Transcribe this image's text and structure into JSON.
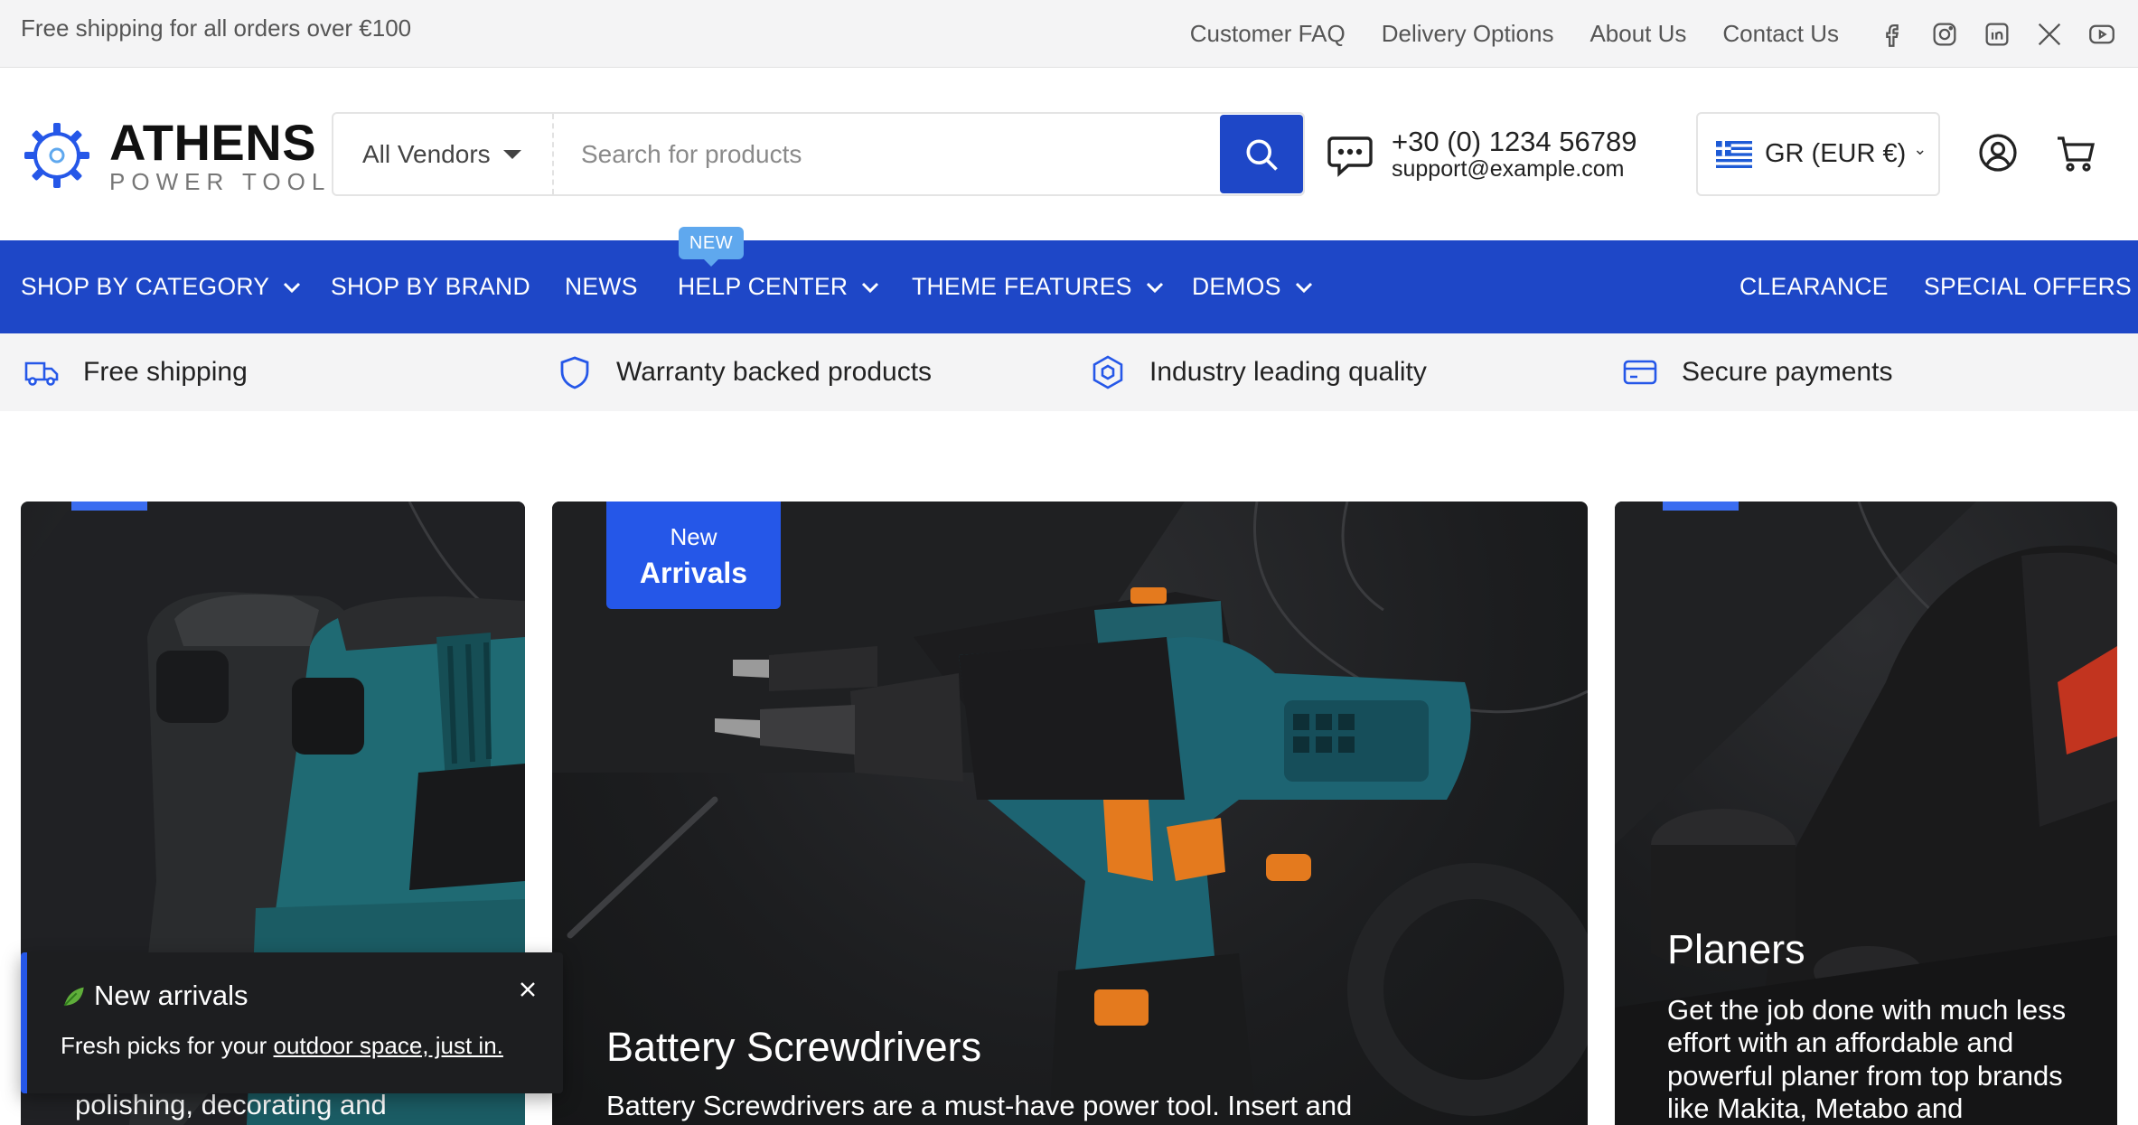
{
  "topbar": {
    "promo": "Free shipping for all orders over €100",
    "links": [
      "Customer FAQ",
      "Delivery Options",
      "About Us",
      "Contact Us"
    ],
    "social_icons": [
      "facebook-icon",
      "instagram-icon",
      "linkedin-icon",
      "x-icon",
      "youtube-icon"
    ]
  },
  "header": {
    "logo_title": "ATHENS",
    "logo_subtitle": "POWER TOOLS",
    "search": {
      "vendor_label": "All Vendors",
      "placeholder": "Search for products"
    },
    "contact": {
      "phone": "+30 (0) 1234 56789",
      "email": "support@example.com"
    },
    "locale": "GR (EUR €)"
  },
  "nav": {
    "items": [
      {
        "label": "SHOP BY CATEGORY",
        "dropdown": true
      },
      {
        "label": "SHOP BY BRAND",
        "dropdown": false
      },
      {
        "label": "NEWS",
        "dropdown": false
      },
      {
        "label": "HELP CENTER",
        "dropdown": true,
        "badge": "NEW"
      },
      {
        "label": "THEME FEATURES",
        "dropdown": true
      },
      {
        "label": "DEMOS",
        "dropdown": true
      },
      {
        "label": "CLEARANCE",
        "dropdown": false
      },
      {
        "label": "SPECIAL OFFERS",
        "dropdown": false
      }
    ]
  },
  "features": [
    {
      "label": "Free shipping",
      "icon": "truck-icon"
    },
    {
      "label": "Warranty backed products",
      "icon": "shield-icon"
    },
    {
      "label": "Industry leading quality",
      "icon": "hexagon-icon"
    },
    {
      "label": "Secure payments",
      "icon": "credit-card-icon"
    }
  ],
  "cards": {
    "left": {
      "text": "polishing, decorating and"
    },
    "center": {
      "badge_line1": "New",
      "badge_line2": "Arrivals",
      "title": "Battery Screwdrivers",
      "text": "Battery Screwdrivers are a must-have power tool. Insert and"
    },
    "right": {
      "title": "Planers",
      "text": "Get the job done with much less effort with an affordable and powerful planer from top brands like Makita, Metabo and"
    }
  },
  "toast": {
    "title": "New arrivals",
    "message": "Fresh picks for your ",
    "link": "outdoor space, just in."
  },
  "colors": {
    "brand_blue": "#1e47c7",
    "accent_blue": "#2557e8",
    "badge_blue": "#5fa8ee"
  }
}
